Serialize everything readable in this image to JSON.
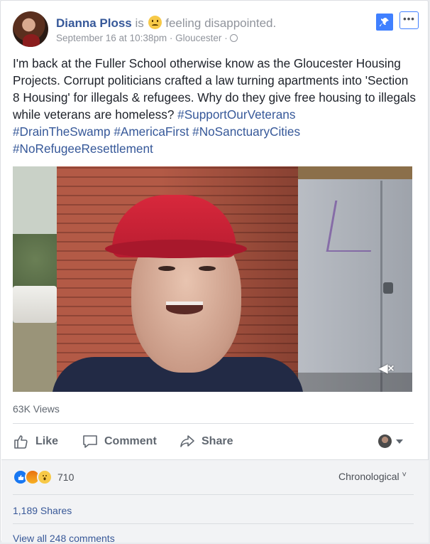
{
  "post": {
    "author": "Dianna Ploss",
    "verb": "is",
    "feeling_emoji": "disappointed-face-emoji",
    "feeling": "feeling disappointed.",
    "date": "September 16 at 10:38pm",
    "separator": "·",
    "location": "Gloucester",
    "privacy_icon": "globe-icon",
    "pin_icon": "pin-icon",
    "more_icon": "•••",
    "text_plain": "I'm back at the Fuller School otherwise know as the Gloucester Housing Projects. Corrupt politicians crafted a law turning apartments into 'Section 8 Housing' for illegals & refugees. Why do they give free housing to illegals while veterans are homeless?",
    "hashtags": [
      "#SupportOurVeterans",
      "#DrainTheSwamp",
      "#AmericaFirst",
      "#NoSanctuaryCities",
      "#NoRefugeeResettlement"
    ]
  },
  "video": {
    "mute_icon": "◀×",
    "views": "63K Views"
  },
  "actions": {
    "like": "Like",
    "comment": "Comment",
    "share": "Share"
  },
  "footer": {
    "reaction_count": "710",
    "sort_label": "Chronological",
    "sort_caret": "˅",
    "shares": "1,189 Shares",
    "view_all": "View all 248 comments"
  }
}
